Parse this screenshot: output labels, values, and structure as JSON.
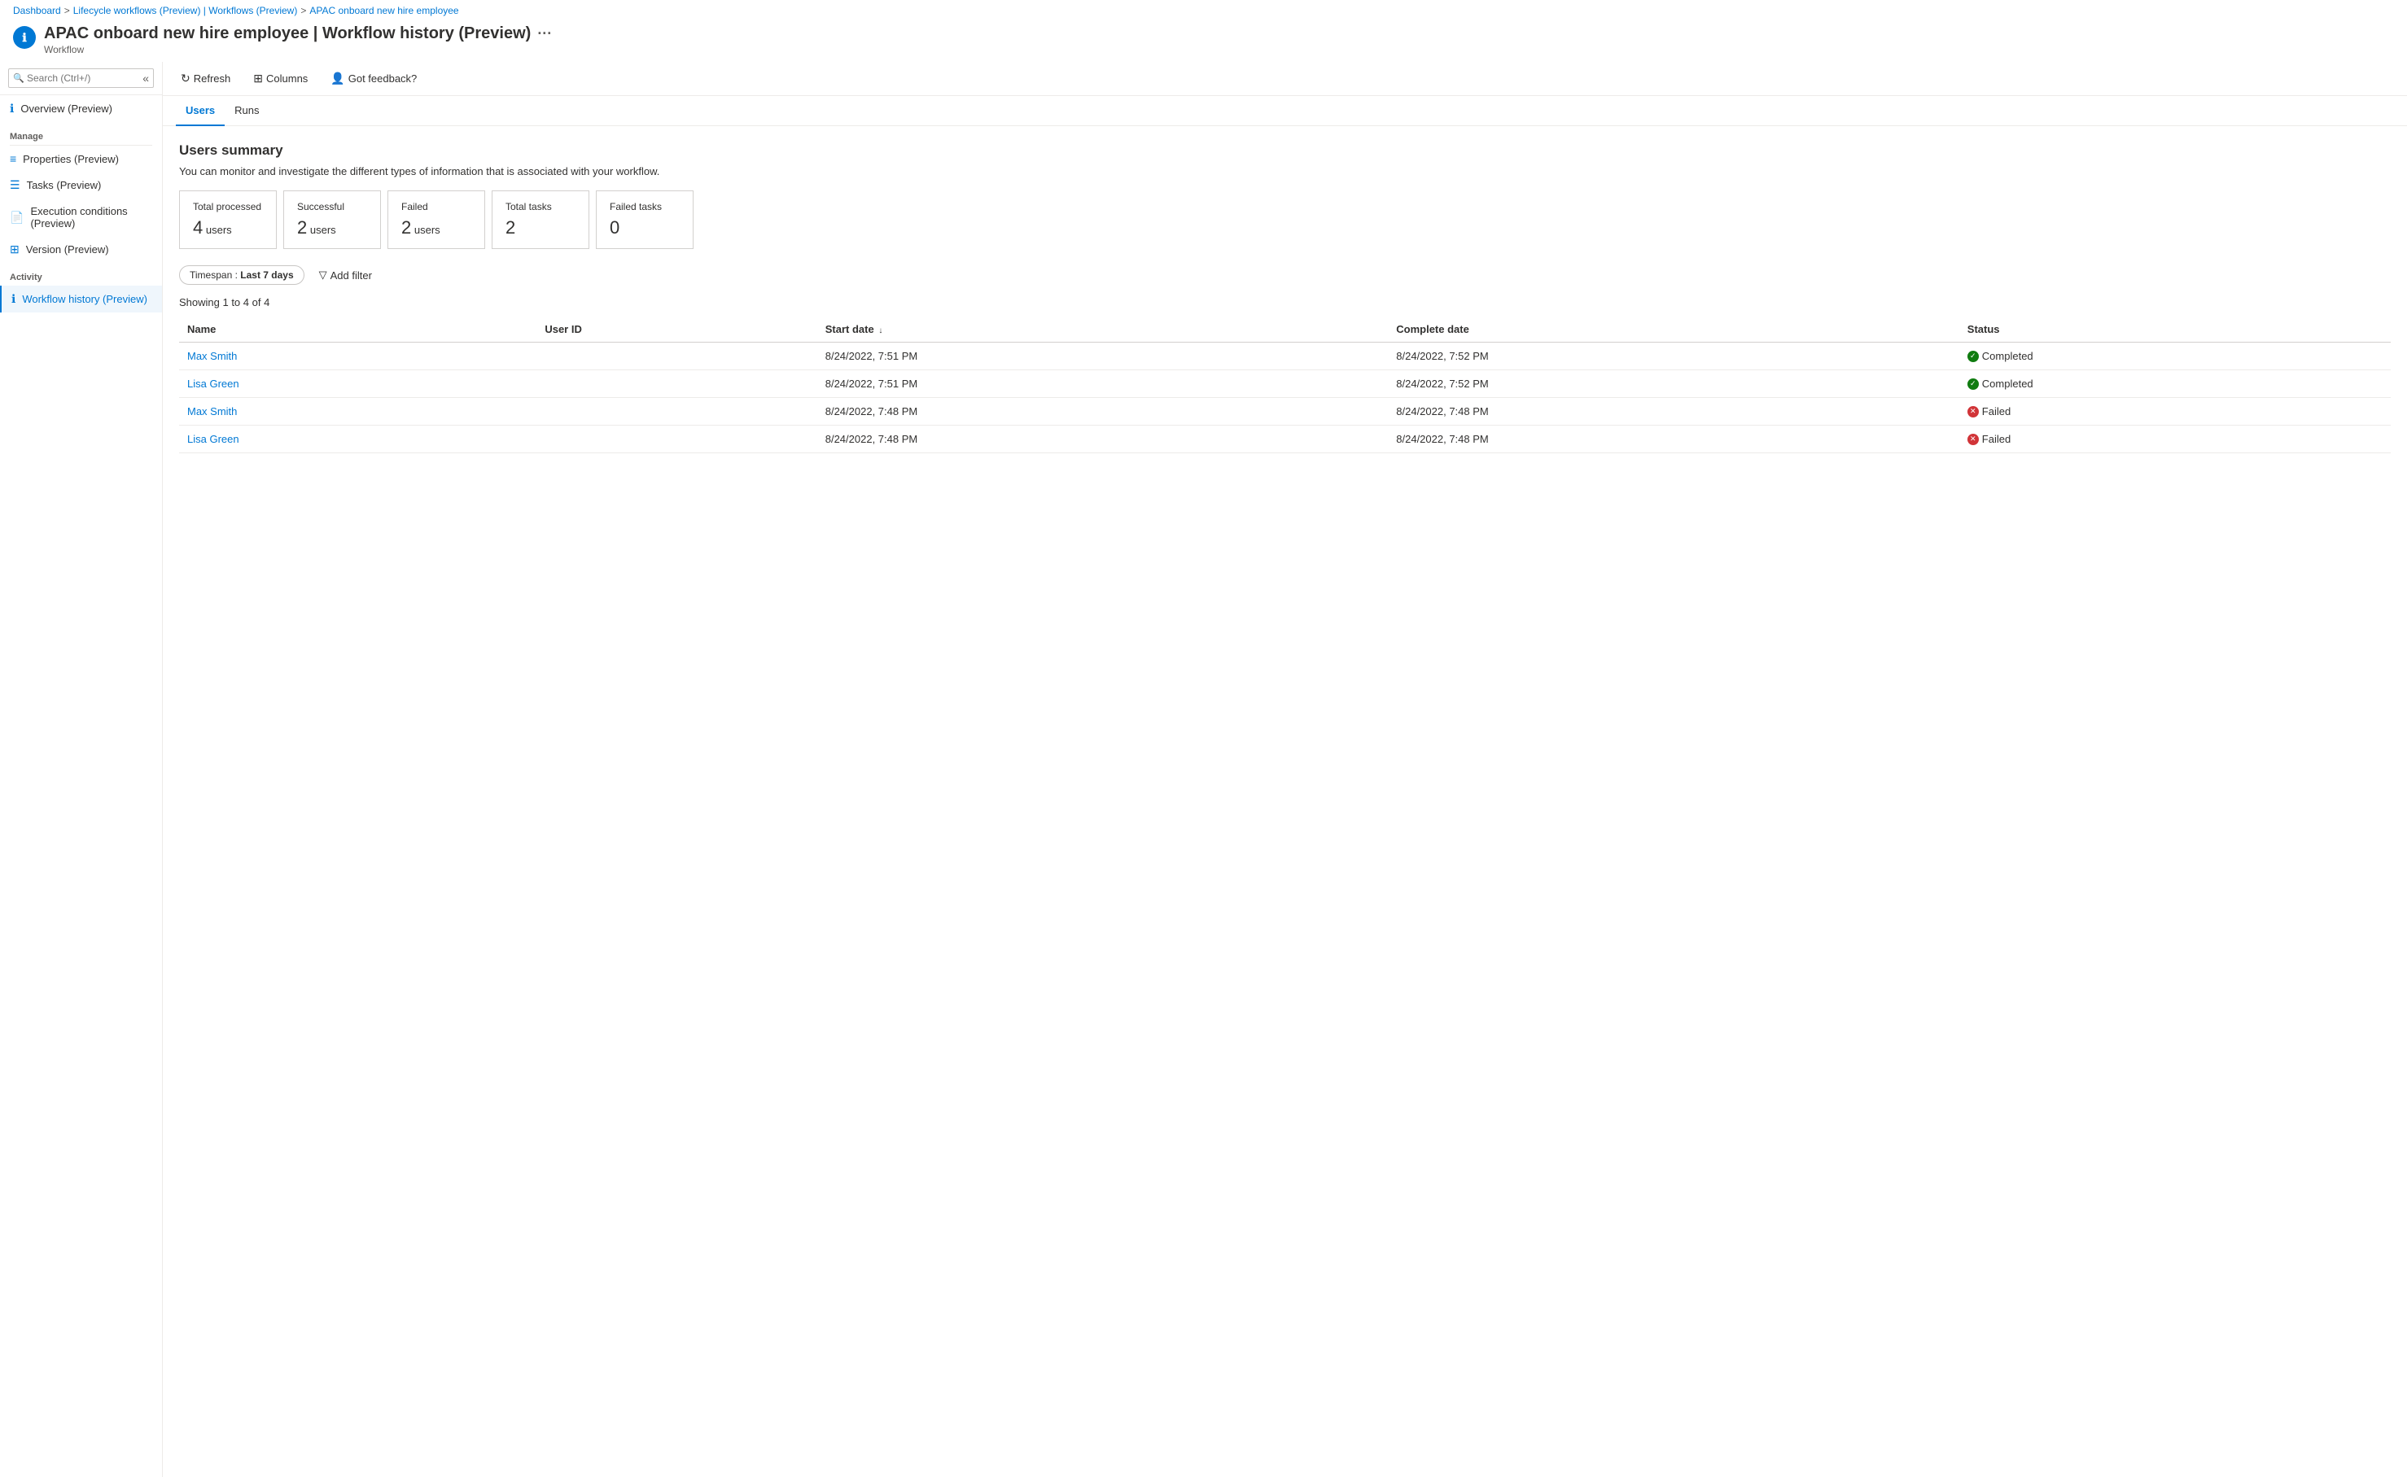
{
  "breadcrumb": {
    "items": [
      {
        "label": "Dashboard",
        "href": "#"
      },
      {
        "label": "Lifecycle workflows (Preview) | Workflows (Preview)",
        "href": "#"
      },
      {
        "label": "APAC onboard new hire employee",
        "href": "#"
      }
    ]
  },
  "page": {
    "title": "APAC onboard new hire employee | Workflow history (Preview)",
    "subtitle": "Workflow",
    "ellipsis": "···"
  },
  "sidebar": {
    "search_placeholder": "Search (Ctrl+/)",
    "overview_label": "Overview (Preview)",
    "manage_section": "Manage",
    "manage_items": [
      {
        "label": "Properties (Preview)",
        "icon": "bars"
      },
      {
        "label": "Tasks (Preview)",
        "icon": "list"
      },
      {
        "label": "Execution conditions (Preview)",
        "icon": "doc"
      },
      {
        "label": "Version (Preview)",
        "icon": "layers"
      }
    ],
    "activity_section": "Activity",
    "activity_items": [
      {
        "label": "Workflow history (Preview)",
        "icon": "info",
        "active": true
      }
    ]
  },
  "toolbar": {
    "refresh_label": "Refresh",
    "columns_label": "Columns",
    "feedback_label": "Got feedback?"
  },
  "tabs": [
    {
      "label": "Users",
      "active": true
    },
    {
      "label": "Runs",
      "active": false
    }
  ],
  "users_summary": {
    "section_title": "Users summary",
    "description": "You can monitor and investigate the different types of information that is associated with your workflow.",
    "cards": [
      {
        "title": "Total processed",
        "value": "4",
        "unit": "users"
      },
      {
        "title": "Successful",
        "value": "2",
        "unit": "users"
      },
      {
        "title": "Failed",
        "value": "2",
        "unit": "users"
      },
      {
        "title": "Total tasks",
        "value": "2",
        "unit": ""
      },
      {
        "title": "Failed tasks",
        "value": "0",
        "unit": ""
      }
    ]
  },
  "filters": {
    "timespan_label": "Timespan",
    "timespan_colon": " : ",
    "timespan_value": "Last 7 days",
    "add_filter_label": "Add filter"
  },
  "table": {
    "showing_text": "Showing 1 to 4 of 4",
    "columns": [
      {
        "label": "Name"
      },
      {
        "label": "User ID"
      },
      {
        "label": "Start date",
        "sort": "↓"
      },
      {
        "label": "Complete date"
      },
      {
        "label": "Status"
      }
    ],
    "rows": [
      {
        "name": "Max Smith",
        "user_id": "",
        "start_date": "8/24/2022, 7:51 PM",
        "complete_date": "8/24/2022, 7:52 PM",
        "status": "Completed",
        "status_type": "completed"
      },
      {
        "name": "Lisa Green",
        "user_id": "",
        "start_date": "8/24/2022, 7:51 PM",
        "complete_date": "8/24/2022, 7:52 PM",
        "status": "Completed",
        "status_type": "completed"
      },
      {
        "name": "Max Smith",
        "user_id": "",
        "start_date": "8/24/2022, 7:48 PM",
        "complete_date": "8/24/2022, 7:48 PM",
        "status": "Failed",
        "status_type": "failed"
      },
      {
        "name": "Lisa Green",
        "user_id": "",
        "start_date": "8/24/2022, 7:48 PM",
        "complete_date": "8/24/2022, 7:48 PM",
        "status": "Failed",
        "status_type": "failed"
      }
    ]
  }
}
